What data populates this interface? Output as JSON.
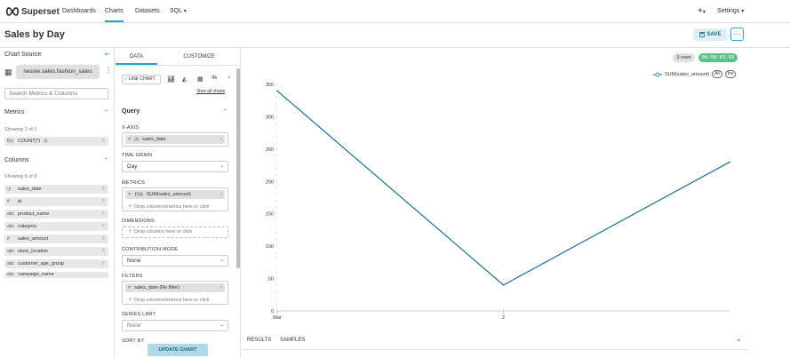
{
  "navbar": {
    "brand": "Superset",
    "links": [
      {
        "label": "Dashboards",
        "active": false
      },
      {
        "label": "Charts",
        "active": true
      },
      {
        "label": "Datasets",
        "active": false
      },
      {
        "label": "SQL",
        "active": false
      }
    ],
    "plus_label": "+",
    "settings_label": "Settings"
  },
  "header": {
    "title": "Sales by Day",
    "save_label": "SAVE",
    "more_label": "···"
  },
  "datasource": {
    "section_title": "Chart Source",
    "dataset_name": "nessie.sales.fashion_sales",
    "search_placeholder": "Search Metrics & Columns",
    "metrics_title": "Metrics",
    "metrics_count": "Showing 1 of 1",
    "metrics": [
      {
        "type": "f(x)",
        "label": "COUNT(*)"
      }
    ],
    "columns_title": "Columns",
    "columns_count": "Showing 8 of 8",
    "columns": [
      {
        "type": "clock",
        "label": "sales_date"
      },
      {
        "type": "#",
        "label": "id"
      },
      {
        "type": "abc",
        "label": "product_name"
      },
      {
        "type": "abc",
        "label": "category"
      },
      {
        "type": "#",
        "label": "sales_amount"
      },
      {
        "type": "abc",
        "label": "store_location"
      },
      {
        "type": "abc",
        "label": "customer_age_group"
      },
      {
        "type": "abc",
        "label": "campaign_name"
      }
    ]
  },
  "controls": {
    "tab_data": "DATA",
    "tab_customize": "CUSTOMIZE",
    "viz_type": "LINE CHART",
    "viz_4k": "4k",
    "view_all": "View all charts",
    "query_title": "Query",
    "xaxis_label": "X-AXIS",
    "xaxis_value": "sales_date",
    "time_grain_label": "TIME GRAIN",
    "time_grain_value": "Day",
    "metrics_label": "METRICS",
    "metrics_value": "SUM(sales_amount)",
    "drop_cols_metrics": "Drop columns/metrics here or click",
    "dimensions_label": "DIMENSIONS",
    "drop_cols": "Drop columns here or click",
    "contribution_label": "CONTRIBUTION MODE",
    "contribution_value": "None",
    "filters_label": "FILTERS",
    "filter_value": "sales_date (No filter)",
    "drop_filters": "Drop columns/metrics here or click",
    "series_limit_label": "SERIES LIMIT",
    "series_limit_value": "None",
    "sort_by_label": "SORT BY",
    "update_label": "UPDATE CHART"
  },
  "chart_panel": {
    "rows_badge": "3 rows",
    "timer": "00:00:03.03",
    "legend_label": "SUM(sales_amount)",
    "legend_all": "All",
    "legend_inv": "Inv",
    "results_tab": "RESULTS",
    "samples_tab": "SAMPLES"
  },
  "chart_data": {
    "type": "line",
    "x": [
      "Mar",
      "2",
      ""
    ],
    "series": [
      {
        "name": "SUM(sales_amount)",
        "values": [
          340,
          40,
          230
        ]
      }
    ],
    "yticks": [
      "0",
      "50",
      "100",
      "150",
      "200",
      "250",
      "300",
      "350"
    ],
    "xticks": [
      "Mar",
      "2"
    ],
    "ylim": [
      0,
      350
    ],
    "color": "#1f6f94"
  }
}
